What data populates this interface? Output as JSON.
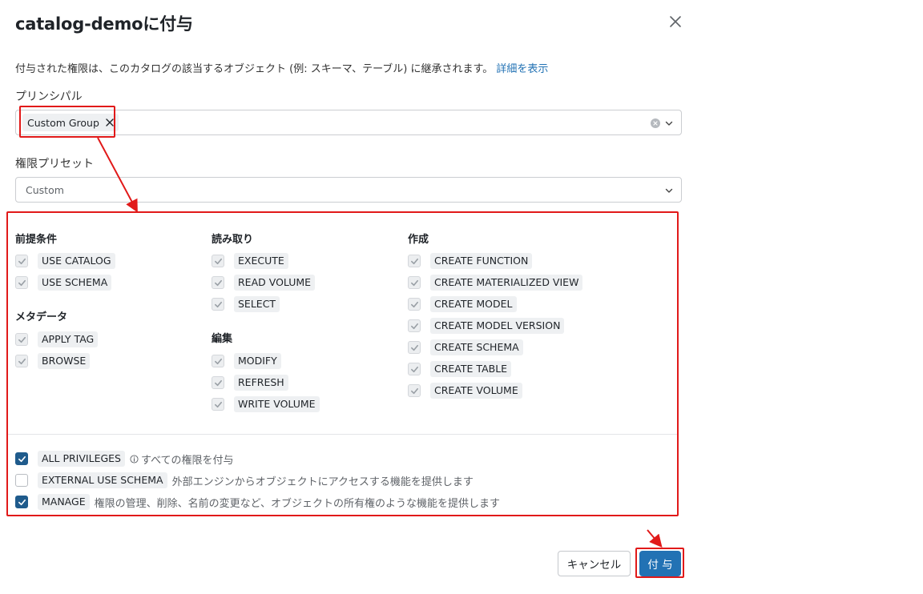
{
  "dialog": {
    "title": "catalog-demoに付与",
    "description": "付与された権限は、このカタログの該当するオブジェクト (例: スキーマ、テーブル) に継承されます。",
    "description_link": "詳細を表示"
  },
  "principal": {
    "label": "プリンシパル",
    "chip": "Custom Group"
  },
  "preset": {
    "label": "権限プリセット",
    "value": "Custom"
  },
  "groups": {
    "prereq": {
      "title": "前提条件",
      "items": [
        "USE CATALOG",
        "USE SCHEMA"
      ]
    },
    "metadata": {
      "title": "メタデータ",
      "items": [
        "APPLY TAG",
        "BROWSE"
      ]
    },
    "read": {
      "title": "読み取り",
      "items": [
        "EXECUTE",
        "READ VOLUME",
        "SELECT"
      ]
    },
    "edit": {
      "title": "編集",
      "items": [
        "MODIFY",
        "REFRESH",
        "WRITE VOLUME"
      ]
    },
    "create": {
      "title": "作成",
      "items": [
        "CREATE FUNCTION",
        "CREATE MATERIALIZED VIEW",
        "CREATE MODEL",
        "CREATE MODEL VERSION",
        "CREATE SCHEMA",
        "CREATE TABLE",
        "CREATE VOLUME"
      ]
    }
  },
  "special": [
    {
      "label": "ALL PRIVILEGES",
      "hint": "すべての権限を付与",
      "checked": true
    },
    {
      "label": "EXTERNAL USE SCHEMA",
      "hint": "外部エンジンからオブジェクトにアクセスする機能を提供します",
      "checked": false
    },
    {
      "label": "MANAGE",
      "hint": "権限の管理、削除、名前の変更など、オブジェクトの所有権のような機能を提供します",
      "checked": true
    }
  ],
  "buttons": {
    "cancel": "キャンセル",
    "grant": "付 与"
  },
  "colors": {
    "accent": "#2272b4",
    "checked": "#1f5b8c",
    "annotation": "#e11919"
  },
  "icons": {
    "close": "close-icon",
    "clear": "clear-circle-icon",
    "caret": "chevron-down-icon",
    "check": "check-icon",
    "info": "info-icon"
  }
}
